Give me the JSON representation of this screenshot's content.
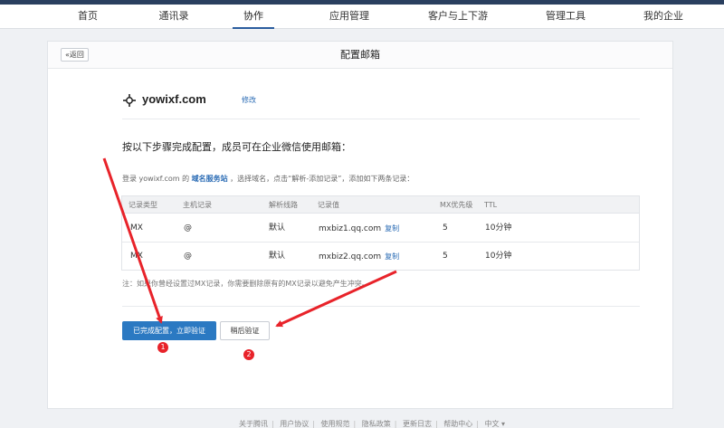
{
  "nav": {
    "items": [
      "首页",
      "通讯录",
      "协作",
      "应用管理",
      "客户与上下游",
      "管理工具",
      "我的企业"
    ],
    "active_index": 2
  },
  "header": {
    "back_label": "«返回",
    "title": "配置邮箱"
  },
  "domain": {
    "name": "yowixf.com",
    "edit_label": "修改",
    "logo_icon": "crosshair-logo-icon"
  },
  "steps": {
    "title": "按以下步骤完成配置，成员可在企业微信使用邮箱：",
    "instr_prefix": "登录 yowixf.com 的",
    "instr_link": "域名服务站",
    "instr_suffix": "，选择域名，点击“解析-添加记录”，添加如下两条记录："
  },
  "table": {
    "headers": [
      "记录类型",
      "主机记录",
      "解析线路",
      "记录值",
      "MX优先级",
      "TTL"
    ],
    "rows": [
      {
        "type": "MX",
        "host": "@",
        "line": "默认",
        "value": "mxbiz1.qq.com",
        "copy": "复制",
        "priority": "5",
        "ttl": "10分钟"
      },
      {
        "type": "MX",
        "host": "@",
        "line": "默认",
        "value": "mxbiz2.qq.com",
        "copy": "复制",
        "priority": "5",
        "ttl": "10分钟"
      }
    ]
  },
  "note": "注：如果你曾经设置过MX记录，你需要删除原有的MX记录以避免产生冲突。",
  "buttons": {
    "primary": "已完成配置，立即验证",
    "secondary": "稍后验证"
  },
  "annotations": {
    "badge1": "1",
    "badge2": "2",
    "color": "#e8232a"
  },
  "footer": {
    "links": [
      "关于腾讯",
      "用户协议",
      "使用规范",
      "隐私政策",
      "更新日志",
      "帮助中心",
      "中文 ▾"
    ]
  },
  "colors": {
    "accent": "#2b79c2",
    "link": "#2b6cb5",
    "topbar": "#2a3f5f"
  }
}
